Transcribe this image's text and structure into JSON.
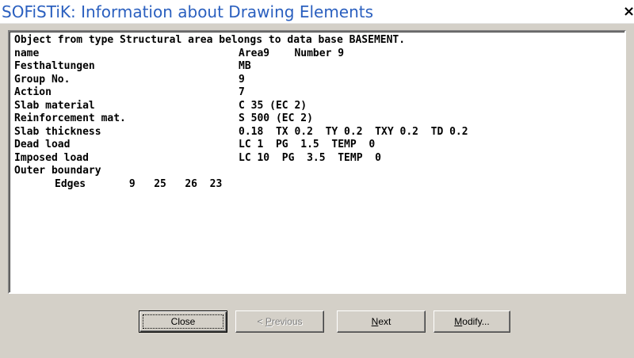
{
  "window": {
    "title": "SOFiSTiK: Information about Drawing Elements",
    "close_glyph": "×"
  },
  "info": {
    "header": "Object from type Structural area belongs to data base BASEMENT.",
    "rows": [
      {
        "label": "name",
        "value": "Area9    Number 9"
      },
      {
        "label": "Festhaltungen",
        "value": "MB"
      },
      {
        "label": "Group No.",
        "value": "9"
      },
      {
        "label": "Action",
        "value": "7"
      },
      {
        "label": "Slab material",
        "value": "C 35 (EC 2)"
      },
      {
        "label": "Reinforcement mat.",
        "value": "S 500 (EC 2)"
      },
      {
        "label": "Slab thickness",
        "value": "0.18  TX 0.2  TY 0.2  TXY 0.2  TD 0.2"
      },
      {
        "label": "Dead load",
        "value": "LC 1  PG  1.5  TEMP  0"
      },
      {
        "label": "Imposed load",
        "value": "LC 10  PG  3.5  TEMP  0"
      }
    ],
    "outer_boundary_label": "Outer boundary",
    "edges_line": "Edges       9   25   26  23"
  },
  "buttons": {
    "close": "Close",
    "previous_prefix": "< ",
    "previous_mnemonic": "P",
    "previous_rest": "revious",
    "next_mnemonic": "N",
    "next_rest": "ext",
    "modify_mnemonic": "M",
    "modify_rest": "odify..."
  }
}
